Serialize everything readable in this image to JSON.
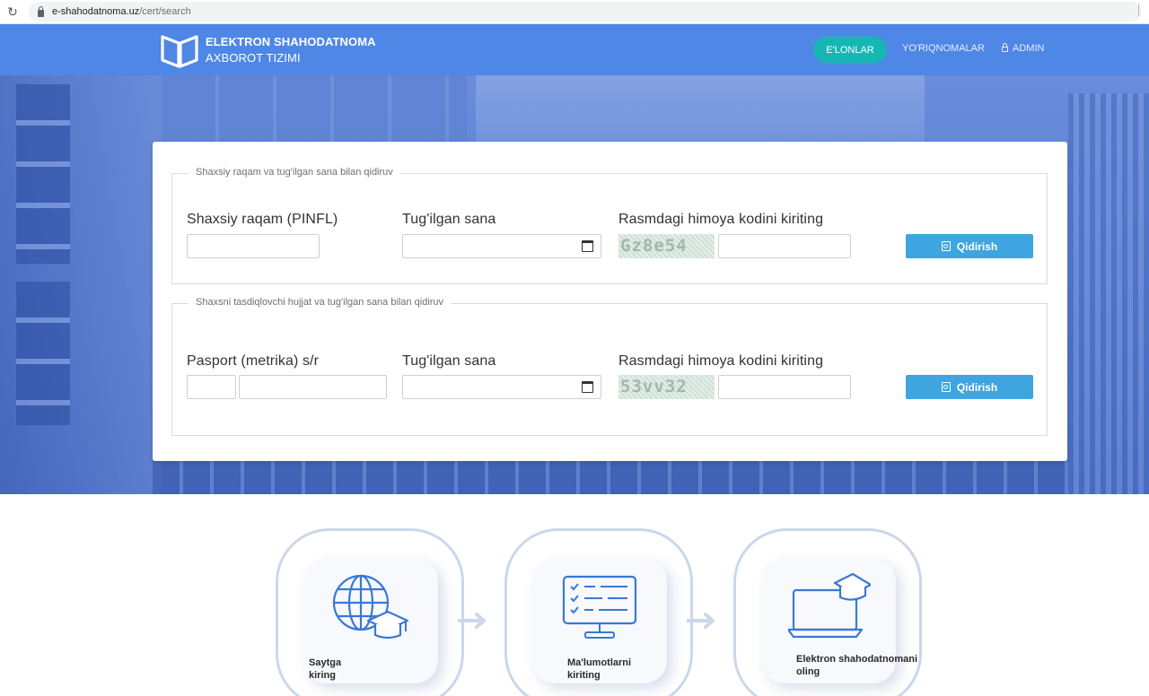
{
  "browser": {
    "url_host": "e-shahodatnoma.uz",
    "url_path": "/cert/search"
  },
  "header": {
    "logo_line1": "ELEKTRON SHAHODATNOMA",
    "logo_line2": "AXBOROT TIZIMI",
    "nav": {
      "announcements": "E'LONLAR",
      "guides": "YO'RIQNOMALAR",
      "admin": "ADMIN"
    }
  },
  "search_pinfl": {
    "legend": "Shaxsiy raqam va tug'ilgan sana bilan qidiruv",
    "pinfl_label": "Shaxsiy raqam (PINFL)",
    "birth_label": "Tug'ilgan sana",
    "captcha_label": "Rasmdagi himoya kodini kiriting",
    "captcha_code": "Gz8e54",
    "button": "Qidirish"
  },
  "search_passport": {
    "legend": "Shaxsni tasdiqlovchi hujjat va tug'ilgan sana bilan qidiruv",
    "passport_label": "Pasport (metrika) s/r",
    "birth_label": "Tug'ilgan sana",
    "captcha_label": "Rasmdagi himoya kodini kiriting",
    "captcha_code": "53vv32",
    "button": "Qidirish"
  },
  "steps": [
    {
      "line1": "Saytga",
      "line2": "kiring",
      "icon": "globe-graduation-cap-icon"
    },
    {
      "line1": "Ma'lumotlarni",
      "line2": "kiriting",
      "icon": "form-monitor-icon"
    },
    {
      "line1": "Elektron shahodatnomani",
      "line2": "oling",
      "icon": "laptop-graduation-cap-icon"
    }
  ],
  "colors": {
    "header_bg": "#4f87e6",
    "nav_active": "#16b7b3",
    "button": "#3ea5e0",
    "icon_blue": "#3a78d6"
  }
}
